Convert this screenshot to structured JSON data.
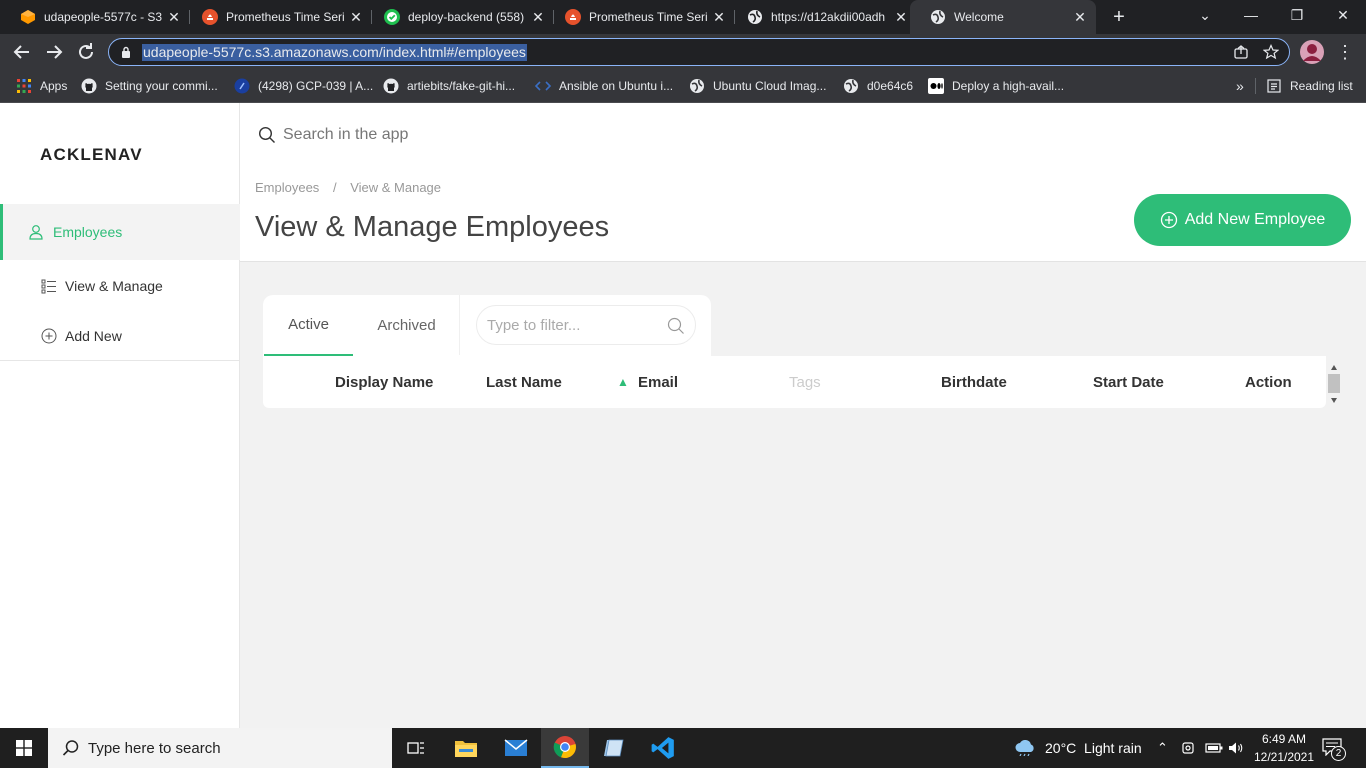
{
  "browser": {
    "tabs": [
      {
        "title": "udapeople-5577c - S3",
        "icon": "aws-icon"
      },
      {
        "title": "Prometheus Time Seri",
        "icon": "prometheus-icon"
      },
      {
        "title": "deploy-backend (558)",
        "icon": "circleci-icon"
      },
      {
        "title": "Prometheus Time Seri",
        "icon": "prometheus-icon"
      },
      {
        "title": "https://d12akdii00adh",
        "icon": "globe-icon"
      },
      {
        "title": "Welcome",
        "icon": "globe-icon"
      }
    ],
    "active_tab": 5,
    "url": "udapeople-5577c.s3.amazonaws.com/index.html#/employees",
    "bookmarks": [
      {
        "label": "Apps",
        "icon": "apps-grid-icon"
      },
      {
        "label": "Setting your commi...",
        "icon": "github-icon"
      },
      {
        "label": "(4298) GCP-039 | A...",
        "icon": "gcp-icon"
      },
      {
        "label": "artiebits/fake-git-hi...",
        "icon": "github-icon"
      },
      {
        "label": "Ansible on Ubuntu i...",
        "icon": "code-icon"
      },
      {
        "label": "Ubuntu Cloud Imag...",
        "icon": "globe-icon"
      },
      {
        "label": "d0e64c6",
        "icon": "globe-icon"
      },
      {
        "label": "Deploy a high-avail...",
        "icon": "medium-icon"
      }
    ],
    "overflow": "»",
    "reading_list": "Reading list"
  },
  "app": {
    "logo": "ACKLENAV",
    "sidebar": [
      {
        "label": "Employees",
        "icon": "user-icon"
      },
      {
        "label": "View & Manage",
        "icon": "list-icon"
      },
      {
        "label": "Add New",
        "icon": "plus-circle-icon"
      }
    ],
    "search_placeholder": "Search in the app",
    "breadcrumb": {
      "root": "Employees",
      "separator": "/",
      "current": "View & Manage"
    },
    "title": "View & Manage Employees",
    "add_button": "Add New Employee",
    "tabs": [
      "Active",
      "Archived"
    ],
    "filter_placeholder": "Type to filter...",
    "columns": [
      "Display Name",
      "Last Name",
      "Email",
      "Tags",
      "Birthdate",
      "Start Date",
      "Action"
    ],
    "sort_indicator": "▲"
  },
  "taskbar": {
    "search_placeholder": "Type here to search",
    "weather": "20°C  Light rain",
    "time": "6:49 AM",
    "date": "12/21/2021",
    "notifications": "2"
  },
  "colors": {
    "accent": "#2ebd78",
    "chrome_dark": "#202124",
    "chrome_toolbar": "#35363a"
  }
}
